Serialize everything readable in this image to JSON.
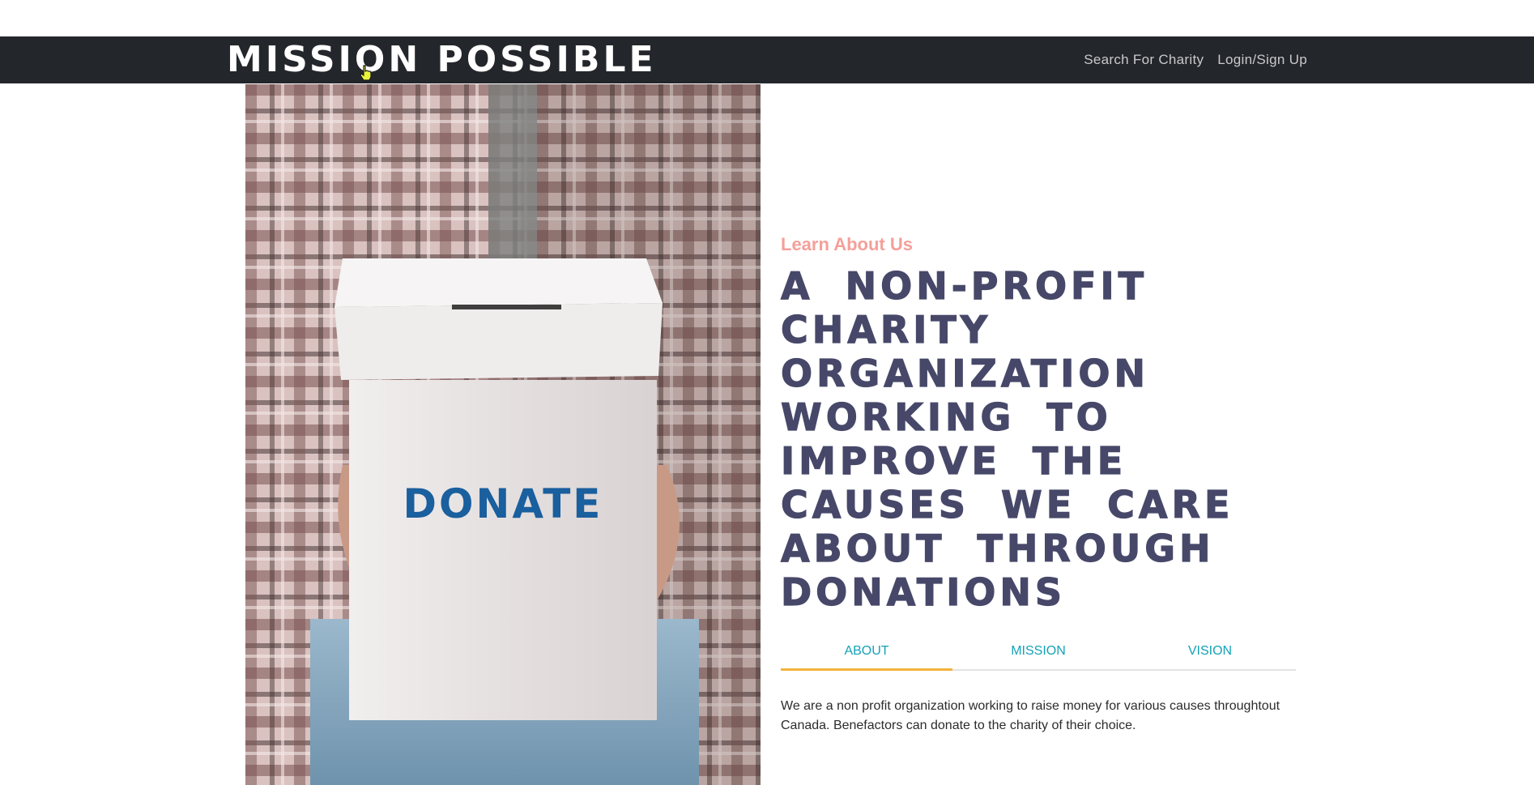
{
  "nav": {
    "brand": "MISSION POSSIBLE",
    "links": [
      "Search For Charity",
      "Login/Sign Up"
    ]
  },
  "hero": {
    "image_box_text": "DONATE"
  },
  "about": {
    "eyebrow": "Learn About Us",
    "headline": "A Non-Profit Charity Organization Working To Improve The Causes We Care About Through Donations",
    "tabs": [
      {
        "label": "ABOUT",
        "active": true
      },
      {
        "label": "MISSION",
        "active": false
      },
      {
        "label": "VISION",
        "active": false
      }
    ],
    "tab_content": "We are a non profit organization working to raise money for various causes throughtout Canada. Benefactors can donate to the charity of their choice."
  },
  "colors": {
    "navbar_bg": "#23262b",
    "headline": "#474869",
    "eyebrow": "#f4a09a",
    "tab_text": "#13a2b8",
    "tab_active_underline": "#f3b33d",
    "donate_text": "#1a5f9e"
  },
  "icons": {
    "cursor": "hand-pointer-icon"
  }
}
